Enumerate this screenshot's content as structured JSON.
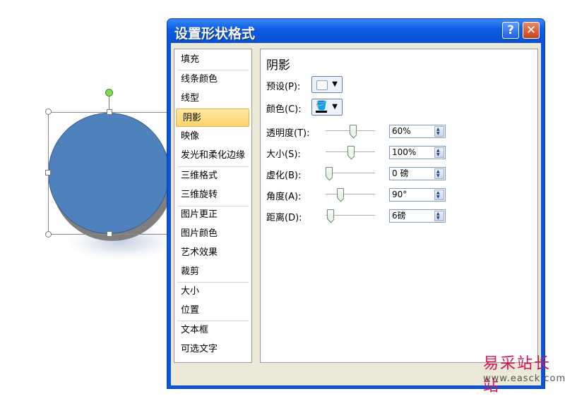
{
  "dialog": {
    "title": "设置形状格式",
    "help_label": "?",
    "close_label": "✕"
  },
  "nav": {
    "items": [
      "填充",
      "线条颜色",
      "线型",
      "阴影",
      "映像",
      "发光和柔化边缘",
      "三维格式",
      "三维旋转",
      "图片更正",
      "图片颜色",
      "艺术效果",
      "裁剪",
      "大小",
      "位置",
      "文本框",
      "可选文字"
    ],
    "active": "阴影"
  },
  "panel": {
    "title": "阴影",
    "preset_label": "预设(P):",
    "color_label": "颜色(C):",
    "rows": [
      {
        "label": "透明度(T):",
        "value": "60%",
        "level": 0.55
      },
      {
        "label": "大小(S):",
        "value": "100%",
        "level": 0.5
      },
      {
        "label": "虚化(B):",
        "value": "0 磅",
        "level": 0.0
      },
      {
        "label": "角度(A):",
        "value": "90°",
        "level": 0.25
      },
      {
        "label": "距离(D):",
        "value": "6磅",
        "level": 0.03
      }
    ]
  },
  "icons": [
    "help-icon",
    "close-icon",
    "paint-bucket-icon",
    "dropdown-arrow-icon",
    "spin-up-icon",
    "spin-down-icon"
  ],
  "colors": {
    "title_bar": "#0a55d8",
    "shape_fill": "#4f81bd",
    "active_nav": "#ffd46b",
    "rotation_handle": "#7ed957"
  },
  "watermark": {
    "cn": "易采站长站",
    "url": "www.easck.com"
  }
}
